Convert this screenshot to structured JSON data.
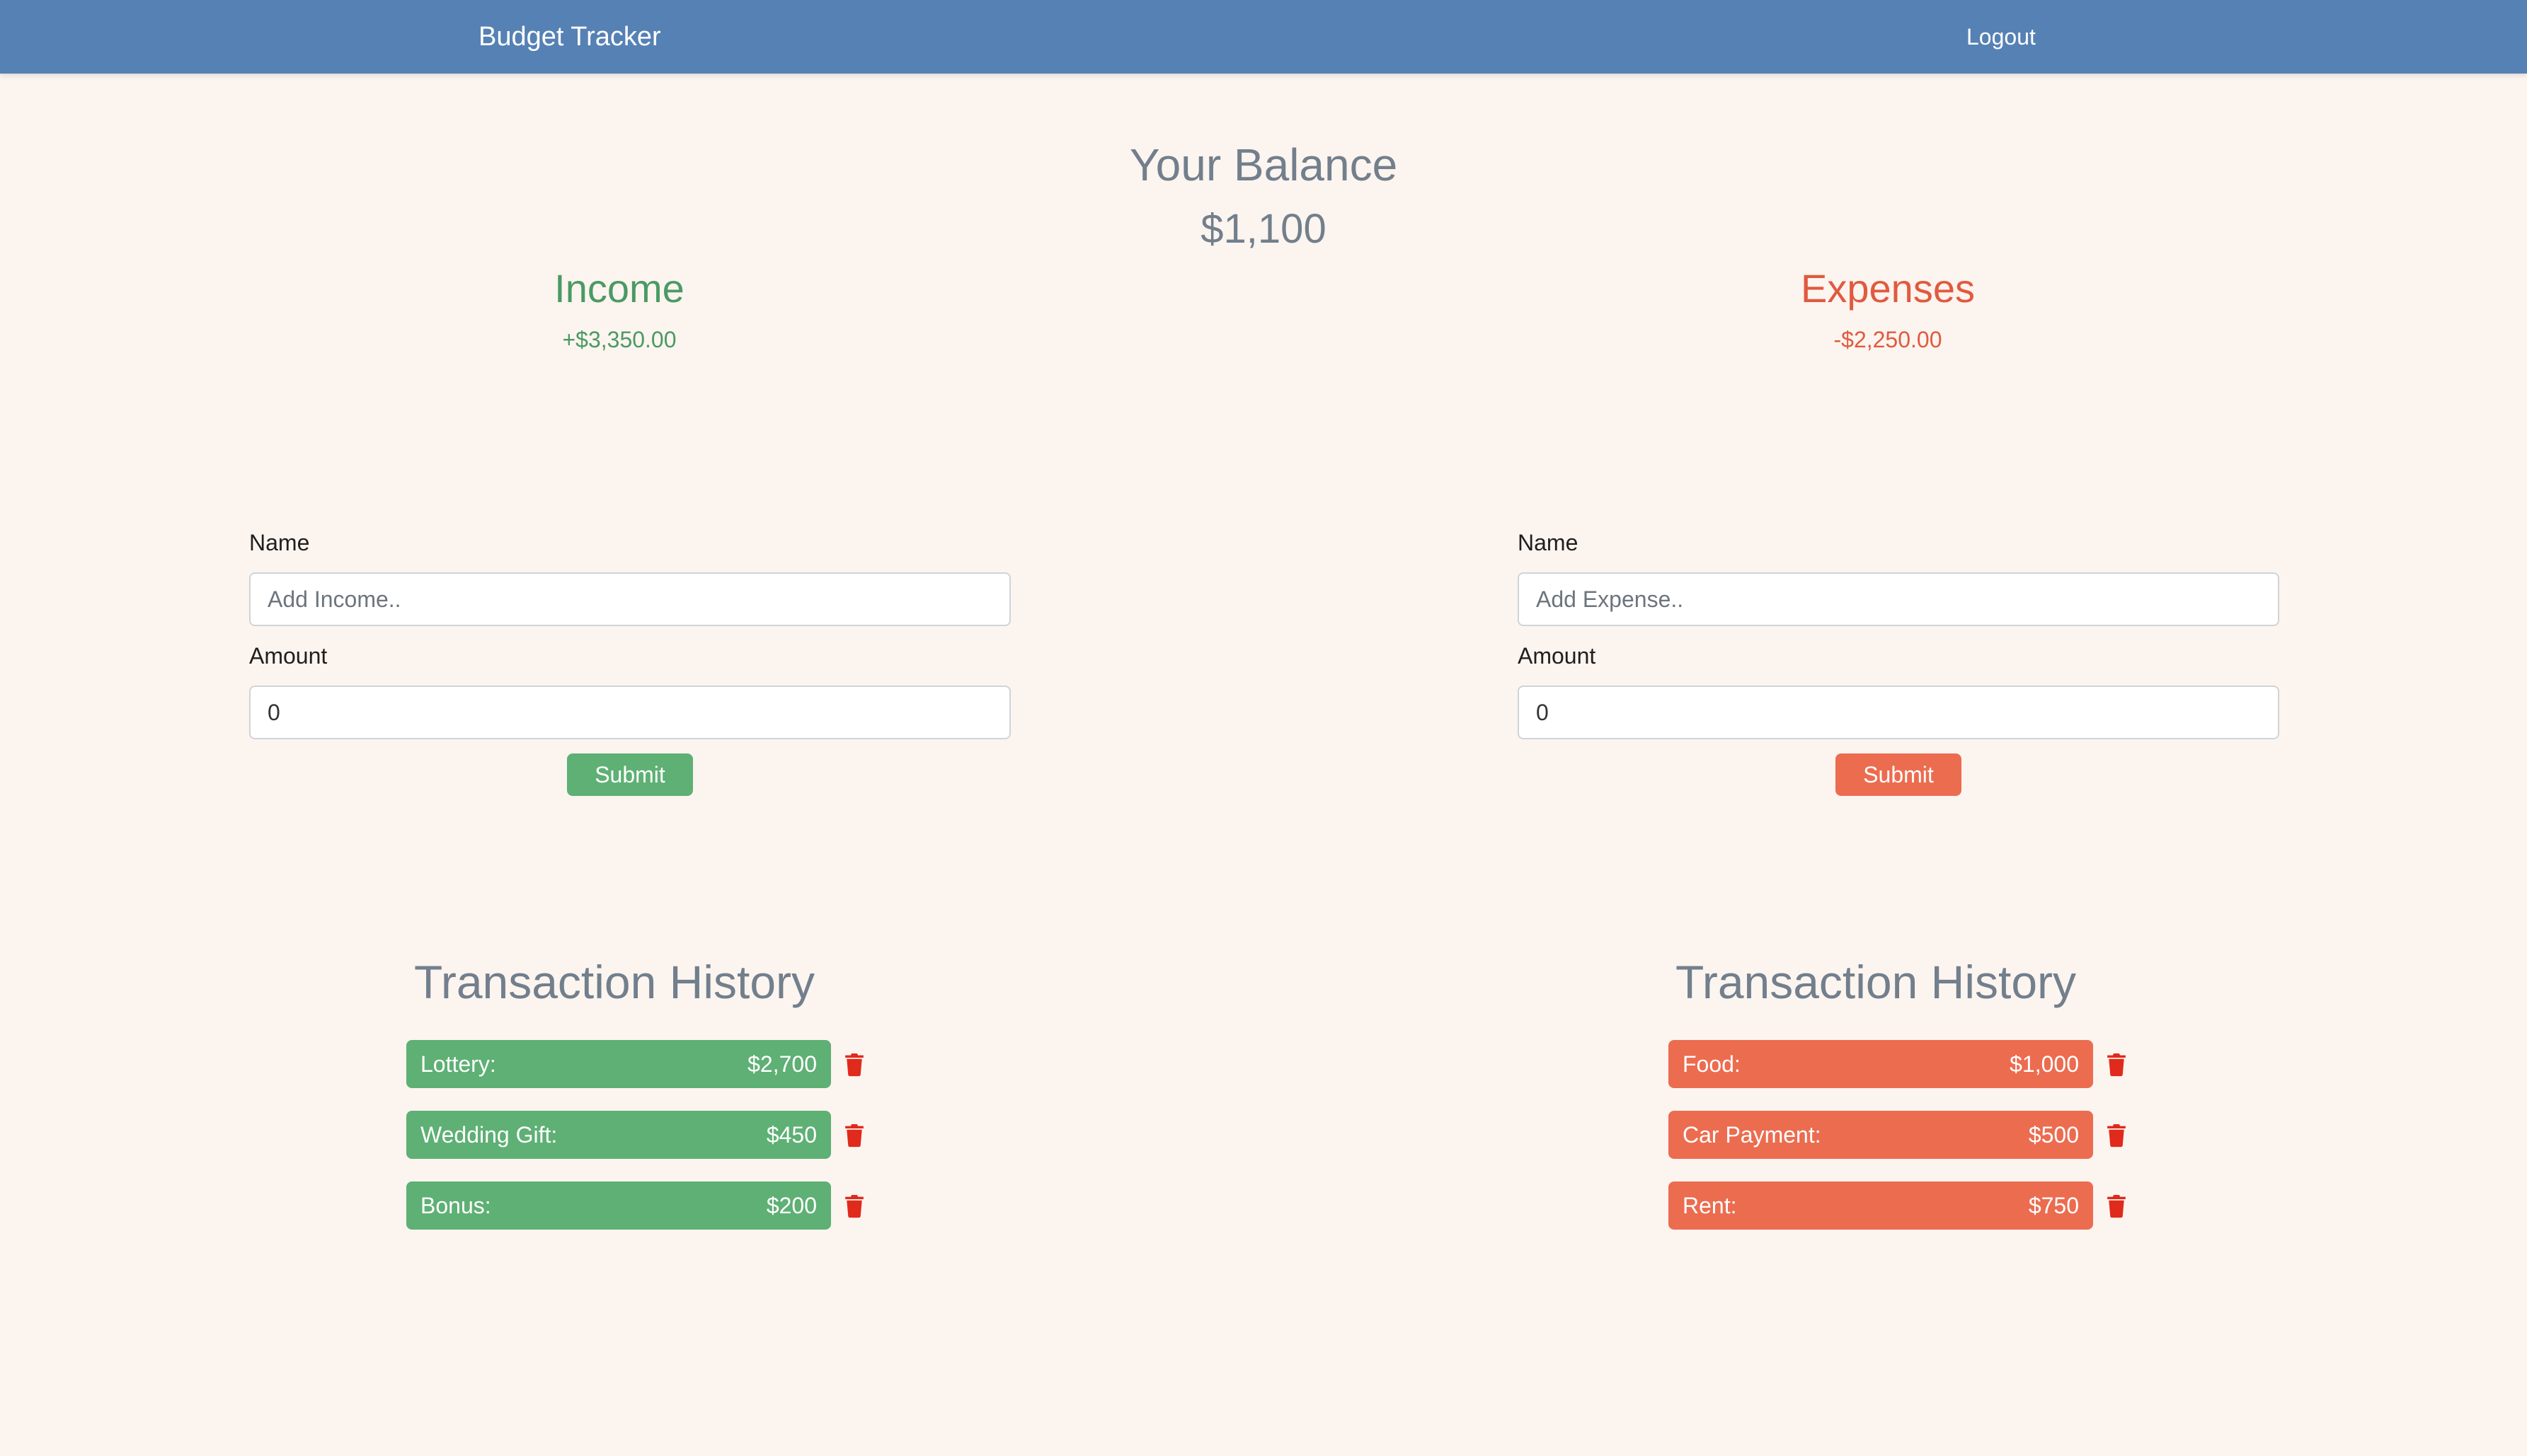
{
  "nav": {
    "brand": "Budget Tracker",
    "logout": "Logout"
  },
  "balance": {
    "title": "Your Balance",
    "value": "$1,100"
  },
  "income": {
    "title": "Income",
    "total": "+$3,350.00",
    "form": {
      "name_label": "Name",
      "name_placeholder": "Add Income..",
      "amount_label": "Amount",
      "amount_value": "0",
      "submit_label": "Submit"
    },
    "history_title": "Transaction History",
    "transactions": [
      {
        "name": "Lottery:",
        "amount": "$2,700"
      },
      {
        "name": "Wedding Gift:",
        "amount": "$450"
      },
      {
        "name": "Bonus:",
        "amount": "$200"
      }
    ]
  },
  "expenses": {
    "title": "Expenses",
    "total": "-$2,250.00",
    "form": {
      "name_label": "Name",
      "name_placeholder": "Add Expense..",
      "amount_label": "Amount",
      "amount_value": "0",
      "submit_label": "Submit"
    },
    "history_title": "Transaction History",
    "transactions": [
      {
        "name": "Food:",
        "amount": "$1,000"
      },
      {
        "name": "Car Payment:",
        "amount": "$500"
      },
      {
        "name": "Rent:",
        "amount": "$750"
      }
    ]
  },
  "colors": {
    "navbar": "#5681b4",
    "background": "#fcf4ef",
    "income": "#5eb074",
    "expense": "#ec6c50",
    "trash": "#e02a1c",
    "heading_gray": "#727f8c"
  },
  "icons": {
    "delete": "trash-icon"
  }
}
